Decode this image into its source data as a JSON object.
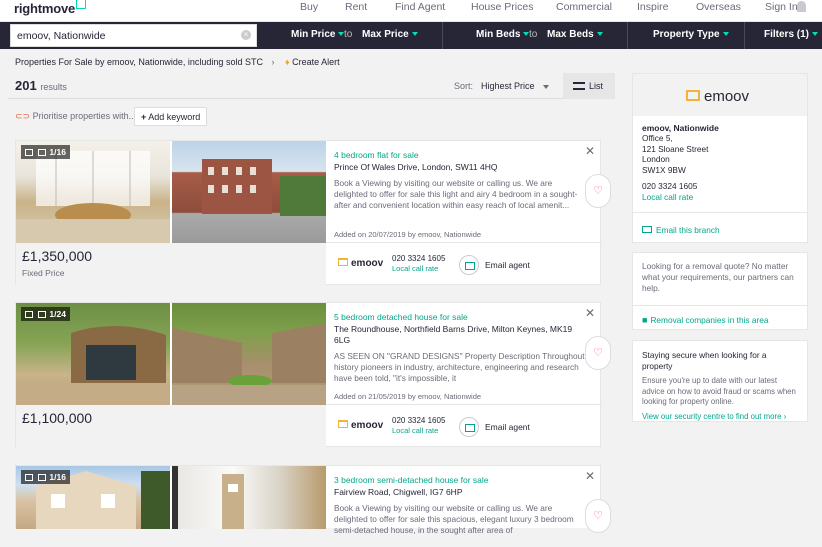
{
  "brand": "rightmove",
  "nav": [
    "Buy",
    "Rent",
    "Find Agent",
    "House Prices",
    "Commercial",
    "Inspire",
    "Overseas",
    "Sign In"
  ],
  "search": {
    "value": "emoov, Nationwide"
  },
  "filters": {
    "min_price": "Min Price",
    "to1": "to",
    "max_price": "Max Price",
    "min_beds": "Min Beds",
    "to2": "to",
    "max_beds": "Max Beds",
    "property_type": "Property Type",
    "filters_label": "Filters (1)"
  },
  "breadcrumb": "Properties For Sale by emoov, Nationwide, including sold STC",
  "create_alert": "Create Alert",
  "results": {
    "count": "201",
    "label": "results"
  },
  "sort": {
    "label": "Sort:",
    "value": "Highest Price"
  },
  "view": "List",
  "prioritise": "Prioritise properties with...",
  "add_keyword": "Add keyword",
  "listings": [
    {
      "photos": "1/16",
      "price": "£1,350,000",
      "qualifier": "Fixed Price",
      "title": "4 bedroom flat for sale",
      "address": "Prince Of Wales Drive, London, SW11 4HQ",
      "desc": "Book a Viewing by visiting our website or calling us. We are delighted to offer for sale this light and airy 4 bedroom in a sought-after and convenient location within easy reach of local amenit...",
      "added": "Added on 20/07/2019 by emoov, Nationwide",
      "phone": "020 3324 1605",
      "rate": "Local call rate",
      "email": "Email agent",
      "agent": "emoov"
    },
    {
      "photos": "1/24",
      "price": "£1,100,000",
      "qualifier": "",
      "title": "5 bedroom detached house for sale",
      "address": "The Roundhouse, Northfield Barns Drive, Milton Keynes, MK19 6LG",
      "desc": "AS SEEN ON \"GRAND DESIGNS\" Property Description Throughout history pioneers in industry, architecture, engineering and research have been told, \"it's impossible, it",
      "added": "Added on 21/05/2019 by emoov, Nationwide",
      "phone": "020 3324 1605",
      "rate": "Local call rate",
      "email": "Email agent",
      "agent": "emoov"
    },
    {
      "photos": "1/16",
      "price": "",
      "qualifier": "",
      "title": "3 bedroom semi-detached house for sale",
      "address": "Fairview Road, Chigwell, IG7 6HP",
      "desc": "Book a Viewing by visiting our website or calling us. We are delighted to offer for sale this spacious, elegant luxury 3 bedroom semi-detached house, in the sought after area of",
      "added": "",
      "phone": "",
      "rate": "",
      "email": "",
      "agent": ""
    }
  ],
  "agent_panel": {
    "logo": "emoov",
    "name": "emoov, Nationwide",
    "address": [
      "Office 5,",
      "121 Sloane Street",
      "London",
      "SW1X 9BW"
    ],
    "phone": "020 3324 1605",
    "rate": "Local call rate",
    "email": "Email this branch"
  },
  "removals": {
    "text": "Looking for a removal quote? No matter what your requirements, our partners can help.",
    "link": "Removal companies in this area"
  },
  "security": {
    "title": "Staying secure when looking for a property",
    "text": "Ensure you're up to date with our latest advice on how to avoid fraud or scams when looking for property online.",
    "link": "View our security centre to find out more ›"
  },
  "colors": {
    "navy": "#262637",
    "teal": "#00deb6",
    "link": "#00a68a",
    "emoov": "#f5b335"
  }
}
